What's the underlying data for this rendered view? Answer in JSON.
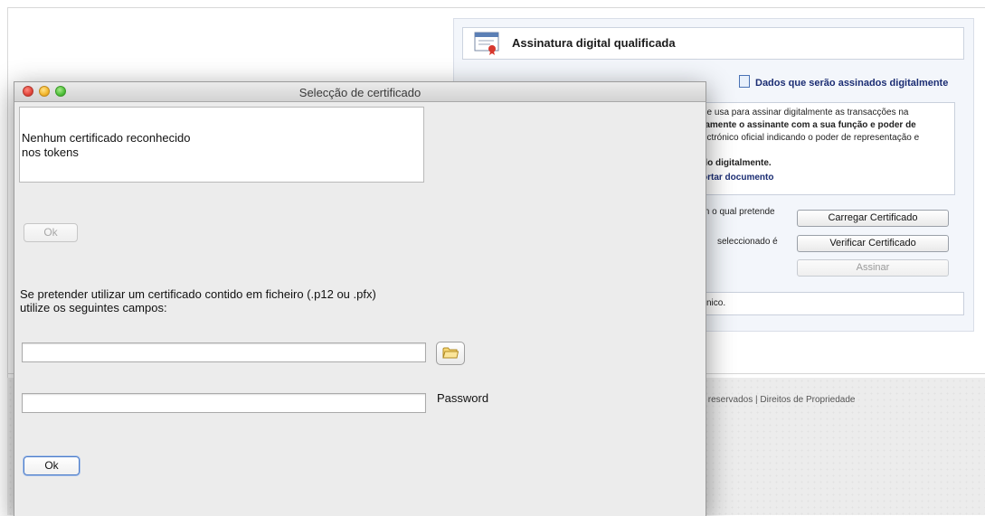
{
  "background_page": {
    "header_title": "Assinatura digital qualificada",
    "signed_data_link": "Dados que serão assinados digitalmente",
    "info_lines": [
      "ue usa para assinar digitalmente as transacções na",
      "tamente o assinante com a sua função e poder de",
      "ectrónico oficial indicando o poder de representação e",
      "do digitalmente.",
      "ortar documento"
    ],
    "row1_text": "m o qual pretende",
    "row2_text": "seleccionado  é",
    "load_cert_button": "Carregar Certificado",
    "verify_cert_button": "Verificar Certificado",
    "sign_button": "Assinar",
    "box_text": "cnico.",
    "footer_text": "s reservados | Direitos de Propriedade"
  },
  "dialog": {
    "title": "Selecção de certificado",
    "token_message_line1": "Nenhum certificado reconhecido",
    "token_message_line2": "nos tokens",
    "token_ok_button": "Ok",
    "file_instruction_line1": "Se pretender utilizar um certificado contido em ficheiro (.p12 ou .pfx)",
    "file_instruction_line2": "utilize os seguintes campos:",
    "file_path_value": "",
    "password_value": "",
    "password_label": "Password",
    "file_ok_button": "Ok"
  }
}
